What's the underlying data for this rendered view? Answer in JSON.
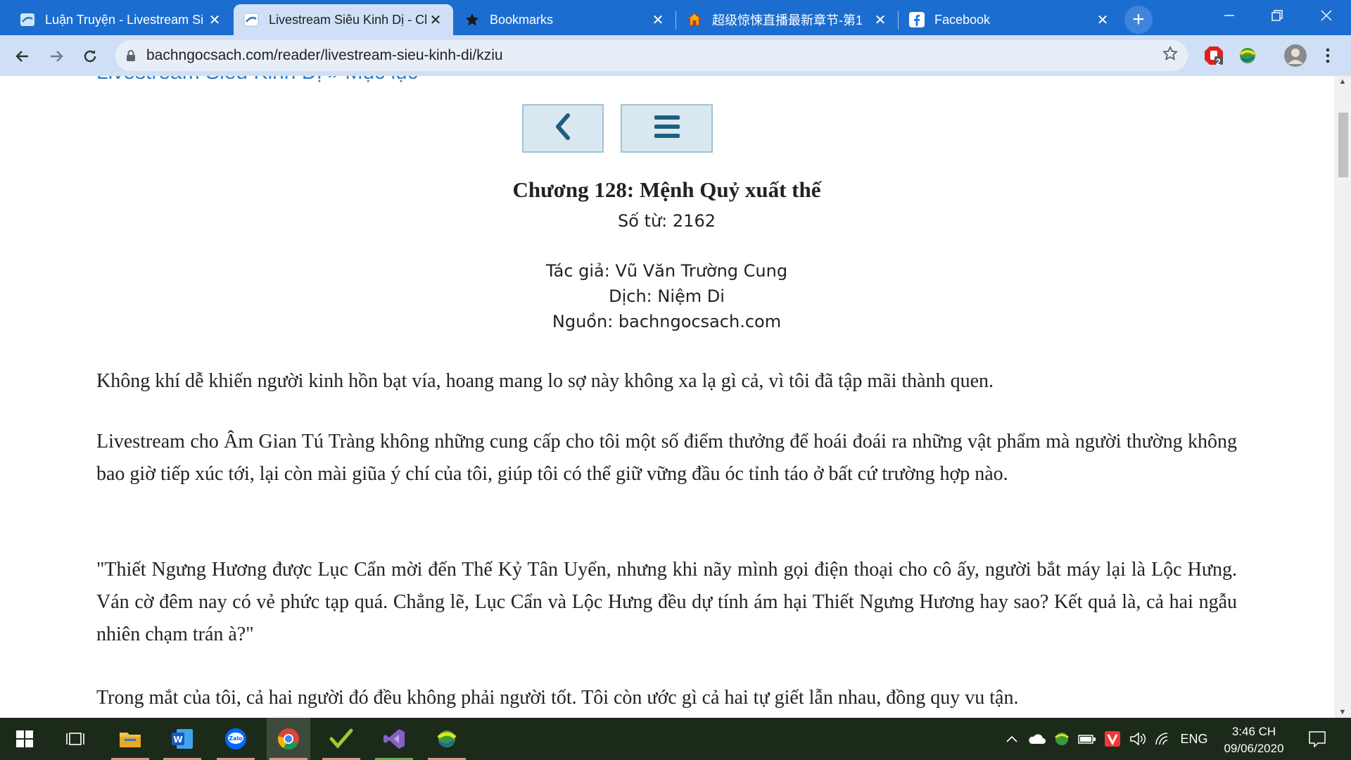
{
  "browser": {
    "tabs": [
      {
        "title": "Luận Truyện - Livestream Si",
        "icon": "site-favicon",
        "active": false
      },
      {
        "title": "Livestream Siêu Kinh Dị - Cl",
        "icon": "site-favicon",
        "active": true
      },
      {
        "title": "Bookmarks",
        "icon": "star-icon",
        "active": false
      },
      {
        "title": "超级惊悚直播最新章节-第1",
        "icon": "house-icon",
        "active": false
      },
      {
        "title": "Facebook",
        "icon": "facebook-icon",
        "active": false
      }
    ],
    "close_glyph": "✕",
    "newtab_glyph": "+",
    "url": "bachngocsach.com/reader/livestream-sieu-kinh-di/kziu",
    "extension_badge": "2"
  },
  "page": {
    "breadcrumb": "Livestream Siêu Kinh Dị » Mục lục",
    "chapter_title": "Chương 128: Mệnh Quỷ xuất thế",
    "word_count": "Số từ: 2162",
    "author": "Tác giả: Vũ Văn Trường Cung",
    "translator": "Dịch: Niệm Di",
    "source": "Nguồn: bachngocsach.com",
    "paragraphs": [
      "Không khí dễ khiến người kinh hồn bạt vía, hoang mang lo sợ này không xa lạ gì cả, vì tôi đã tập mãi thành quen.",
      "Livestream cho Âm Gian Tú Tràng không những cung cấp cho tôi một số điểm thưởng để hoái đoái ra những vật phẩm mà người thường không bao giờ tiếp xúc tới, lại còn mài giũa ý chí của tôi, giúp tôi có thể giữ vững đầu óc tỉnh táo ở bất cứ trường hợp nào.",
      "\"Thiết Ngưng Hương được Lục Cẩn mời đến Thế Kỷ Tân Uyển, nhưng khi nãy mình gọi điện thoại cho cô ấy, người bắt máy lại là Lộc Hưng. Ván cờ đêm nay có vẻ phức tạp quá. Chẳng lẽ, Lục Cẩn và Lộc Hưng đều dự tính ám hại Thiết Ngưng Hương hay sao? Kết quả là, cả hai ngẫu nhiên chạm trán à?\"",
      "Trong mắt của tôi, cả hai người đó đều không phải người tốt. Tôi còn ước gì cả hai tự giết lẫn nhau, đồng quy vu tận."
    ]
  },
  "taskbar": {
    "language": "ENG",
    "time": "3:46 CH",
    "date": "09/06/2020"
  },
  "colors": {
    "tabstrip": "#1c6dd0",
    "active_tab": "#cfe0f6",
    "link": "#2f7dc5",
    "nav_button": "#d9e8f0",
    "nav_icon": "#1e5f80",
    "taskbar": "#1c2a1a"
  }
}
